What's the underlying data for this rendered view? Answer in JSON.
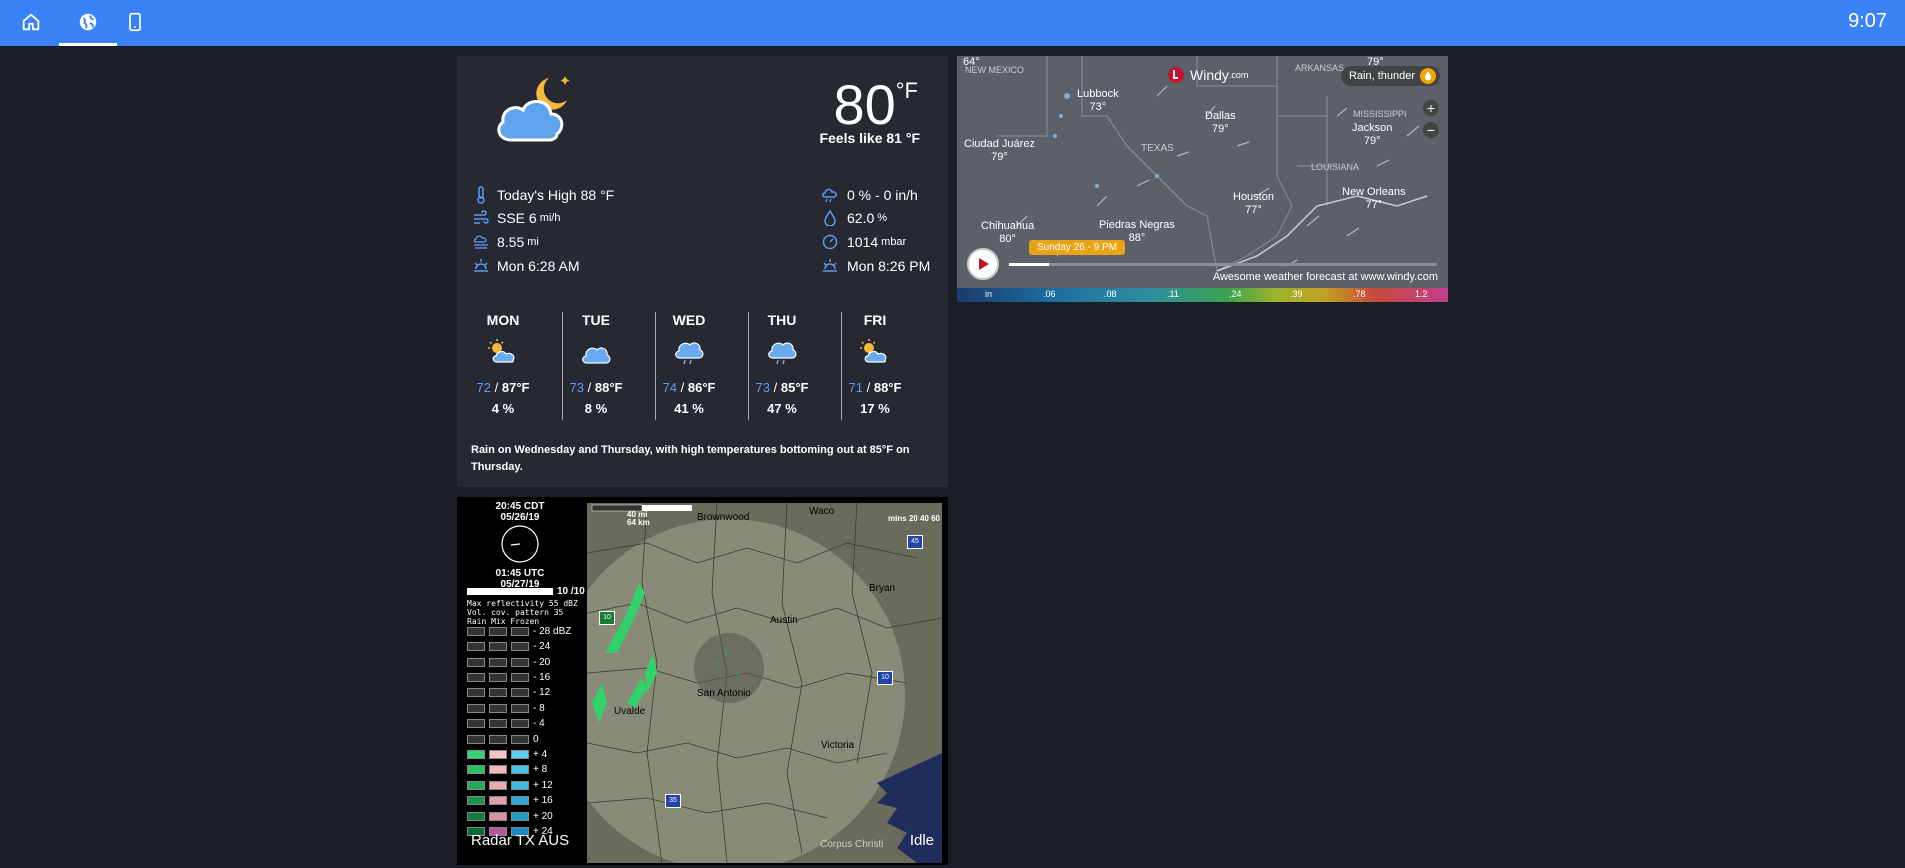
{
  "topbar": {
    "clock": "9:07",
    "nav": [
      "home-icon",
      "globe-icon",
      "tablet-icon"
    ],
    "active": 1
  },
  "current": {
    "temp": "80",
    "unit": "°F",
    "feels_like": "Feels like 81 °F",
    "high": "Today's High 88 °F",
    "wind_dir": "SSE 6",
    "wind_unit": "mi/h",
    "visibility": "8.55",
    "visibility_unit": "mi",
    "sunrise": "Mon 6:28 AM",
    "precip": "0 % - 0 in/h",
    "humidity": "62.0",
    "humidity_unit": "%",
    "pressure": "1014",
    "pressure_unit": "mbar",
    "sunset": "Mon 8:26 PM"
  },
  "forecast": [
    {
      "day": "MON",
      "lo": "72",
      "hi": "87°F",
      "pop": "4 %",
      "icon": "partly-sunny-icon"
    },
    {
      "day": "TUE",
      "lo": "73",
      "hi": "88°F",
      "pop": "8 %",
      "icon": "cloudy-icon"
    },
    {
      "day": "WED",
      "lo": "74",
      "hi": "86°F",
      "pop": "41 %",
      "icon": "rain-icon"
    },
    {
      "day": "THU",
      "lo": "73",
      "hi": "85°F",
      "pop": "47 %",
      "icon": "rain-icon"
    },
    {
      "day": "FRI",
      "lo": "71",
      "hi": "88°F",
      "pop": "17 %",
      "icon": "partly-sunny-icon"
    }
  ],
  "forecast_slash": "/",
  "summary": "Rain on Wednesday and Thursday, with high temperatures bottoming out at 85°F on Thursday.",
  "windy": {
    "brand": "Windy",
    "brand_suffix": ".com",
    "layer": "Rain, thunder",
    "time": "Sunday 26 - 9 PM",
    "footer": "Awesome weather forecast at www.windy.com",
    "scale": [
      "in",
      ".06",
      ".08",
      ".11",
      ".24",
      ".39",
      ".78",
      "1.2"
    ],
    "cities": [
      {
        "name": "Lubbock",
        "temp": "73°"
      },
      {
        "name": "Dallas",
        "temp": "79°"
      },
      {
        "name": "Jackson",
        "temp": "79°"
      },
      {
        "name": "Ciudad Juárez",
        "temp": "79°"
      },
      {
        "name": "Houston",
        "temp": "77°"
      },
      {
        "name": "New Orleans",
        "temp": "77°"
      },
      {
        "name": "Chihuahua",
        "temp": "80°"
      },
      {
        "name": "Piedras Negras",
        "temp": "88°"
      }
    ],
    "regions": [
      "TEXAS",
      "MISSISSIPPI",
      "LOUISIANA",
      "ARKANSAS",
      "NEW MEXICO"
    ],
    "edge_temps": [
      "64°",
      "79°"
    ],
    "zoom_in": "+",
    "zoom_out": "−"
  },
  "radar": {
    "time_local": "20:45 CDT",
    "date_local": "05/26/19",
    "time_utc": "01:45 UTC",
    "date_utc": "05/27/19",
    "frame": "10 /10",
    "info1": "Max reflectivity 55 dBZ",
    "info2": "Vol. cov. pattern 35",
    "info3": "Rain Mix Frozen",
    "levels": [
      "- 28 dBZ",
      "- 24",
      "- 20",
      "- 16",
      "- 12",
      "- 8",
      "- 4",
      "0",
      "+ 4",
      "+ 8",
      "+ 12",
      "+ 16",
      "+ 20",
      "+ 24"
    ],
    "title": "Radar TX AUS",
    "status": "Idle",
    "scale_mi": "40 mi",
    "scale_km": "64 km",
    "mins": "mins 20  40  60",
    "places": [
      "Brownwood",
      "Waco",
      "Bryan",
      "Austin",
      "San Antonio",
      "Uvalde",
      "Victoria",
      "Corpus Christi"
    ],
    "highways": [
      "45",
      "10",
      "10",
      "35"
    ]
  }
}
